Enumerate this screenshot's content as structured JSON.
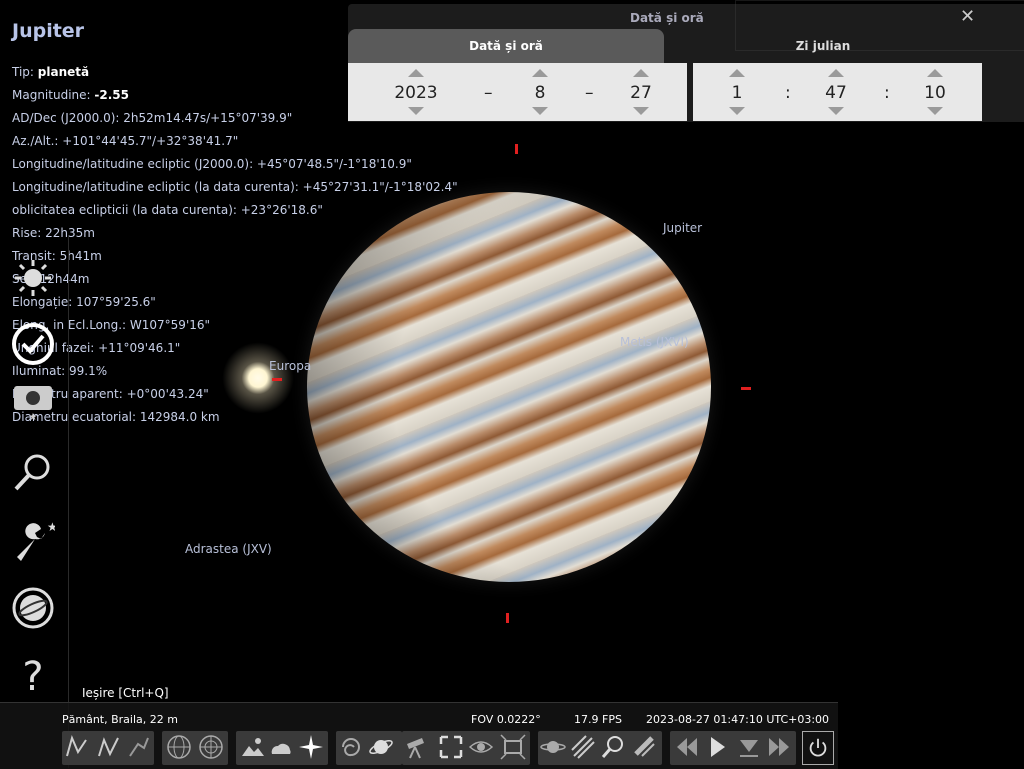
{
  "object": {
    "name": "Jupiter",
    "info": [
      {
        "label": "Tip: ",
        "value": "planetă"
      },
      {
        "label": "Magnitudine: ",
        "value": "-2.55"
      },
      {
        "label": "AD/Dec (J2000.0): 2h52m14.47s/+15°07'39.9\"",
        "value": ""
      },
      {
        "label": "Az./Alt.: +101°44'45.7\"/+32°38'41.7\"",
        "value": ""
      },
      {
        "label": "Longitudine/latitudine ecliptic (J2000.0): +45°07'48.5\"/-1°18'10.9\"",
        "value": ""
      },
      {
        "label": "Longitudine/latitudine ecliptic (la data curenta): +45°27'31.1\"/-1°18'02.4\"",
        "value": ""
      },
      {
        "label": "oblicitatea eclipticii (la data curenta): +23°26'18.6\"",
        "value": ""
      },
      {
        "label": "Rise: 22h35m",
        "value": ""
      },
      {
        "label": "Transit: 5h41m",
        "value": ""
      },
      {
        "label": "Set: 12h44m",
        "value": ""
      },
      {
        "label": "Elongație: 107°59'25.6\"",
        "value": ""
      },
      {
        "label": "Elong. in Ecl.Long.: W107°59'16\"",
        "value": ""
      },
      {
        "label": "Unghiul fazei: +11°09'46.1\"",
        "value": ""
      },
      {
        "label": "Iluminat: 99.1%",
        "value": ""
      },
      {
        "label": "Diametru aparent: +0°00'43.24\"",
        "value": ""
      },
      {
        "label": "Diametru ecuatorial: 142984.0 km",
        "value": ""
      }
    ]
  },
  "sky_labels": {
    "jupiter": "Jupiter",
    "europa": "Europa",
    "metis": "Metis (JXVI)",
    "adrastea": "Adrastea (JXV)"
  },
  "date_panel": {
    "title": "Dată și oră",
    "tab_date": "Dată și oră",
    "tab_julian": "Zi julian",
    "close": "✕",
    "year": "2023",
    "month": "8",
    "day": "27",
    "hour": "1",
    "minute": "47",
    "second": "10",
    "date_sep": "–",
    "time_sep": ":"
  },
  "left_bar": {
    "items": [
      "sun-location-icon",
      "clock-icon",
      "sky-display-icon",
      "search-icon",
      "settings-icon",
      "astrocalc-icon",
      "help-icon"
    ],
    "selected": "clock-icon"
  },
  "bottom": {
    "exit_hint": "Ieșire  [Ctrl+Q]",
    "location": "Pământ, Braila, 22 m",
    "fov": "FOV 0.0222°",
    "fps": "17.9 FPS",
    "datetime": "2023-08-27 01:47:10 UTC+03:00"
  }
}
